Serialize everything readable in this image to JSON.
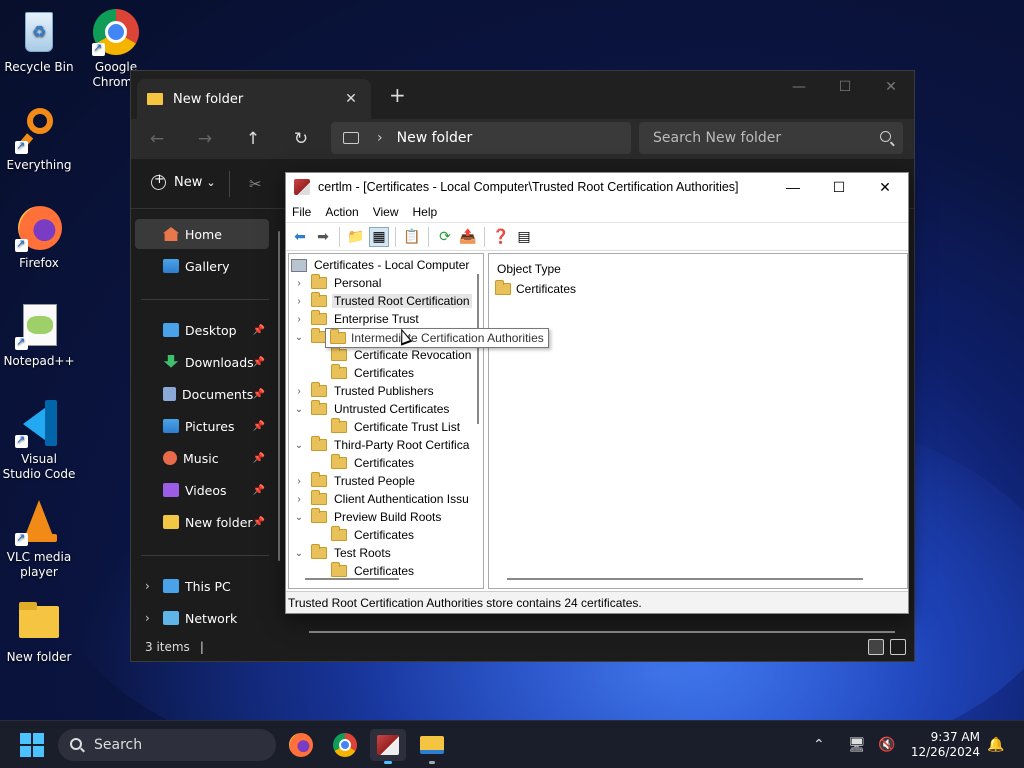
{
  "desktop": {
    "icons": [
      {
        "label": "Recycle Bin"
      },
      {
        "label": "Google Chrome"
      },
      {
        "label": "Everything"
      },
      {
        "label": "Firefox"
      },
      {
        "label": "Notepad++"
      },
      {
        "label": "Visual Studio Code"
      },
      {
        "label": "VLC media player"
      },
      {
        "label": "New folder"
      }
    ]
  },
  "explorer": {
    "tab_title": "New folder",
    "tab_close": "✕",
    "new_tab": "+",
    "controls": {
      "minimize": "—",
      "maximize": "☐",
      "close": "✕"
    },
    "nav": {
      "back": "←",
      "forward": "→",
      "up": "↑",
      "refresh": "↻"
    },
    "address": {
      "chevron": "›",
      "path": "New folder"
    },
    "search_placeholder": "Search New folder",
    "toolbar": {
      "new_label": "New",
      "new_chevron": "⌄",
      "cut": "✂"
    },
    "sidebar": {
      "home": "Home",
      "gallery": "Gallery",
      "pinned": [
        {
          "label": "Desktop",
          "color": "#4aa3e8"
        },
        {
          "label": "Downloads",
          "color": "#3fbf6e"
        },
        {
          "label": "Documents",
          "color": "#8aa8d8"
        },
        {
          "label": "Pictures",
          "color": "#4aa3e8"
        },
        {
          "label": "Music",
          "color": "#e86a4a"
        },
        {
          "label": "Videos",
          "color": "#9b5de5"
        },
        {
          "label": "New folder",
          "color": "#f2c744"
        }
      ],
      "pin_glyph": "📌",
      "this_pc": "This PC",
      "network": "Network",
      "expand_chevron": "›"
    },
    "status": {
      "items": "3 items",
      "cursor": "|"
    }
  },
  "certlm": {
    "title": "certlm - [Certificates - Local Computer\\Trusted Root Certification Authorities]",
    "controls": {
      "minimize": "—",
      "maximize": "☐",
      "close": "✕"
    },
    "menu": [
      "File",
      "Action",
      "View",
      "Help"
    ],
    "toolbar": [
      "⬅",
      "➡",
      "📁",
      "▦",
      "📋",
      "⟳",
      "📤",
      "❓",
      "▤"
    ],
    "tree_root": "Certificates - Local Computer",
    "tree": [
      {
        "label": "Personal",
        "chev": "›",
        "indent": 0
      },
      {
        "label": "Trusted Root Certification",
        "chev": "›",
        "indent": 0
      },
      {
        "label": "Enterprise Trust",
        "chev": "›",
        "indent": 0
      },
      {
        "label": "Intermediate Certification Authorities",
        "chev": "⌄",
        "indent": 0
      },
      {
        "label": "Certificate Revocation",
        "chev": "",
        "indent": 1
      },
      {
        "label": "Certificates",
        "chev": "",
        "indent": 1
      },
      {
        "label": "Trusted Publishers",
        "chev": "›",
        "indent": 0
      },
      {
        "label": "Untrusted Certificates",
        "chev": "⌄",
        "indent": 0
      },
      {
        "label": "Certificate Trust List",
        "chev": "",
        "indent": 1
      },
      {
        "label": "Third-Party Root Certifica",
        "chev": "⌄",
        "indent": 0
      },
      {
        "label": "Certificates",
        "chev": "",
        "indent": 1
      },
      {
        "label": "Trusted People",
        "chev": "›",
        "indent": 0
      },
      {
        "label": "Client Authentication Issu",
        "chev": "›",
        "indent": 0
      },
      {
        "label": "Preview Build Roots",
        "chev": "⌄",
        "indent": 0
      },
      {
        "label": "Certificates",
        "chev": "",
        "indent": 1
      },
      {
        "label": "Test Roots",
        "chev": "⌄",
        "indent": 0
      },
      {
        "label": "Certificates",
        "chev": "",
        "indent": 1
      }
    ],
    "list_header": "Object Type",
    "list_items": [
      "Certificates"
    ],
    "status": "Trusted Root Certification Authorities store contains 24 certificates.",
    "tooltip": "Intermediate Certification Authorities"
  },
  "taskbar": {
    "search_placeholder": "Search",
    "time": "9:37 AM",
    "date": "12/26/2024",
    "tray": {
      "chevron": "⌃",
      "display": "🖥",
      "volume": "🔇",
      "bell": "🔔"
    }
  }
}
